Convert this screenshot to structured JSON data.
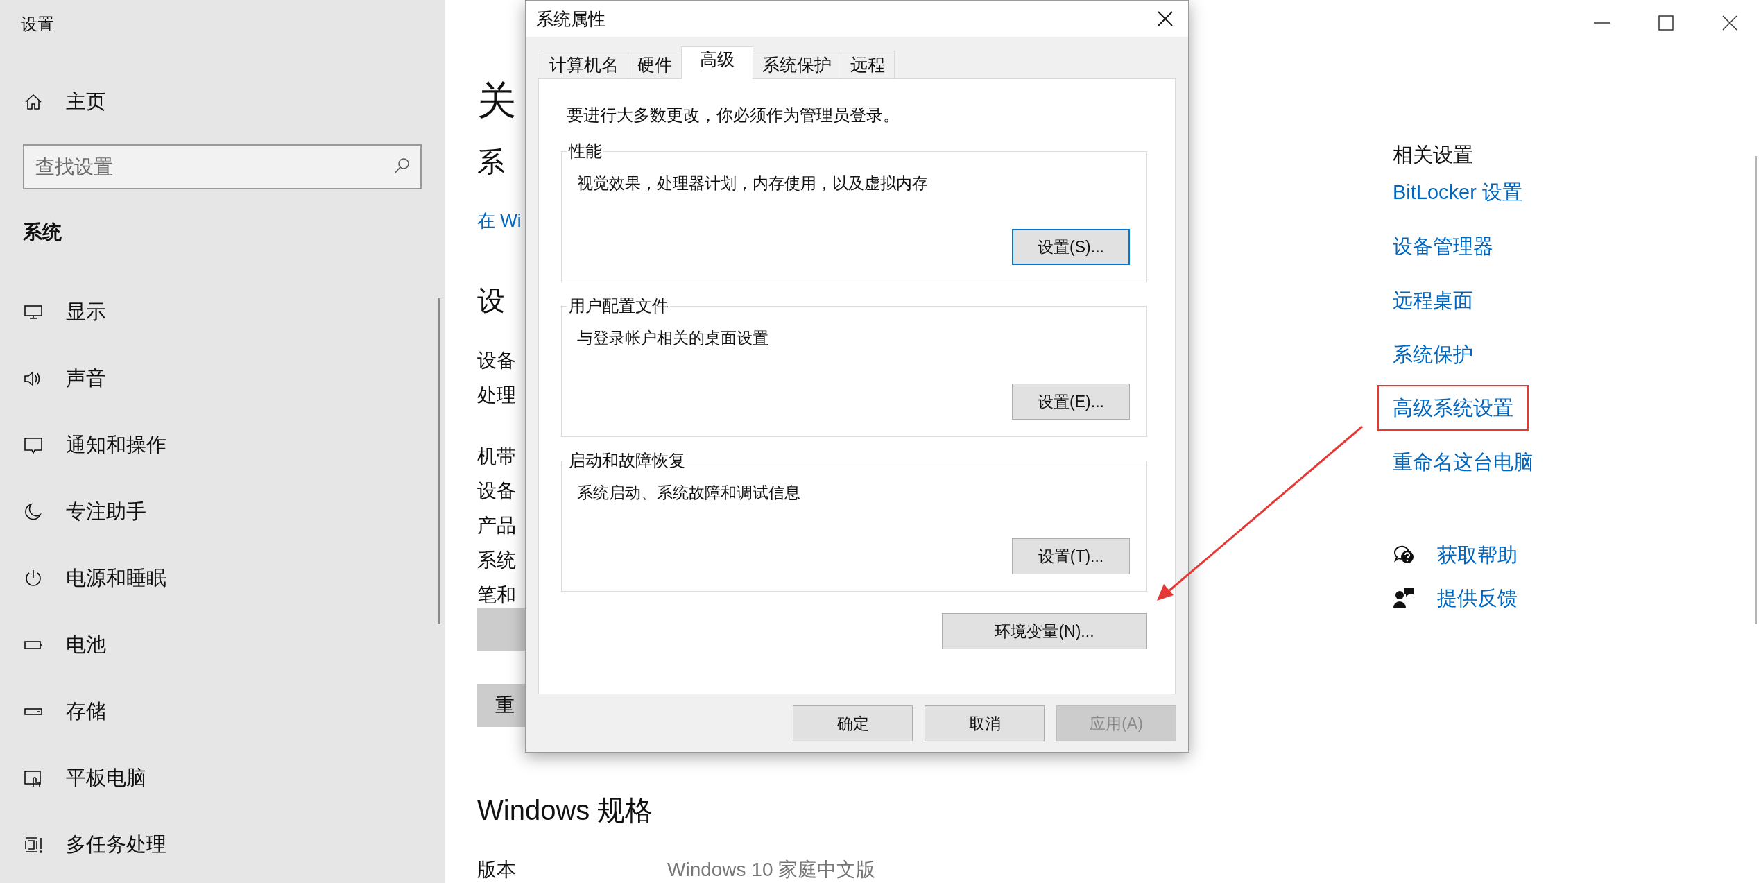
{
  "window": {
    "title": "设置"
  },
  "sidebar": {
    "home": "主页",
    "search": {
      "placeholder": "查找设置"
    },
    "section": "系统",
    "items": [
      {
        "label": "显示"
      },
      {
        "label": "声音"
      },
      {
        "label": "通知和操作"
      },
      {
        "label": "专注助手"
      },
      {
        "label": "电源和睡眠"
      },
      {
        "label": "电池"
      },
      {
        "label": "存储"
      },
      {
        "label": "平板电脑"
      },
      {
        "label": "多任务处理"
      }
    ]
  },
  "main": {
    "heading": "关",
    "subheading": "系",
    "link": "在 Wi",
    "section": "设",
    "device_rows": [
      "设备",
      "处理"
    ],
    "spec_rows": [
      "机带",
      "设备",
      "产品",
      "系统",
      "笔和"
    ],
    "buttons": [
      {
        "kind": "plain"
      },
      {
        "kind": "labeled",
        "label": "重"
      }
    ],
    "windows_spec": {
      "heading": "Windows 规格",
      "rows": [
        {
          "label": "版本",
          "value": "Windows 10 家庭中文版"
        }
      ]
    }
  },
  "related": {
    "heading": "相关设置",
    "links": [
      {
        "label": "BitLocker 设置",
        "highlighted": false
      },
      {
        "label": "设备管理器",
        "highlighted": false
      },
      {
        "label": "远程桌面",
        "highlighted": false
      },
      {
        "label": "系统保护",
        "highlighted": false
      },
      {
        "label": "高级系统设置",
        "highlighted": true
      },
      {
        "label": "重命名这台电脑",
        "highlighted": false
      }
    ]
  },
  "support": [
    {
      "label": "获取帮助"
    },
    {
      "label": "提供反馈"
    }
  ],
  "dialog": {
    "title": "系统属性",
    "tabs": [
      {
        "label": "计算机名",
        "selected": false
      },
      {
        "label": "硬件",
        "selected": false
      },
      {
        "label": "高级",
        "selected": true
      },
      {
        "label": "系统保护",
        "selected": false
      },
      {
        "label": "远程",
        "selected": false
      }
    ],
    "notice": "要进行大多数更改，你必须作为管理员登录。",
    "groups": [
      {
        "legend": "性能",
        "description": "视觉效果，处理器计划，内存使用，以及虚拟内存",
        "button": {
          "label": "设置(S)...",
          "focused": true
        }
      },
      {
        "legend": "用户配置文件",
        "description": "与登录帐户相关的桌面设置",
        "button": {
          "label": "设置(E)...",
          "focused": false
        }
      },
      {
        "legend": "启动和故障恢复",
        "description": "系统启动、系统故障和调试信息",
        "button": {
          "label": "设置(T)...",
          "focused": false
        }
      }
    ],
    "env_button": "环境变量(N)...",
    "buttons": [
      {
        "label": "确定",
        "disabled": false
      },
      {
        "label": "取消",
        "disabled": false
      },
      {
        "label": "应用(A)",
        "disabled": true
      }
    ]
  }
}
